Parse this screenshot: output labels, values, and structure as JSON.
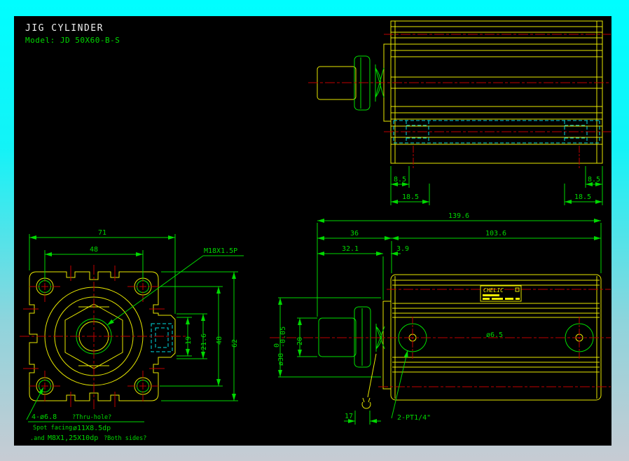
{
  "header": {
    "title": "JIG CYLINDER",
    "model": "Model: JD 50X60-B-S"
  },
  "colors": {
    "canvas": "#000000",
    "frame_top": "#00FEFF",
    "frame_bottom": "#C7CBD3",
    "geometry_yellow": "#E8E800",
    "geometry_green": "#00E000",
    "dimension_green": "#00D800",
    "centerline_red": "#C00000",
    "hidden_cyan": "#00DDE2"
  },
  "side_view_top": {
    "dim_left_inner": "8.5",
    "dim_left_outer": "18.5",
    "dim_right_inner": "8.5",
    "dim_right_outer": "18.5"
  },
  "front_view": {
    "dim_width_total": "71",
    "dim_bolt_spacing_h": "48",
    "dim_boss_inner": "19",
    "dim_boss_outer": "21.6",
    "dim_bolt_spacing_v": "48",
    "dim_height_total": "62",
    "thread_callout": "M18X1.5P",
    "notes": {
      "l1a": "4-ø6.8",
      "l1b": "?Thru-hole?",
      "l2a": "Spot facing",
      "l2b": "ø11X8.5dp",
      "l3a": ".and",
      "l3b": "M8X1,25X10dp",
      "l3c": "?Both sides?"
    }
  },
  "side_view_front": {
    "dim_total_length": "139.6",
    "dim_head_length": "36",
    "dim_body_length": "103.6",
    "dim_rod_length": "32.1",
    "dim_plate_thickness": "3.9",
    "dim_rod_dia": "ø38",
    "dim_rod_tol_upper": "0",
    "dim_rod_tol_lower": "-0.05",
    "dim_rod_width": "20",
    "dim_wrench_flats": "17",
    "port_callout": "2-PT1/4\"",
    "brand": "CHELIC",
    "center_note": "ø6.5"
  }
}
